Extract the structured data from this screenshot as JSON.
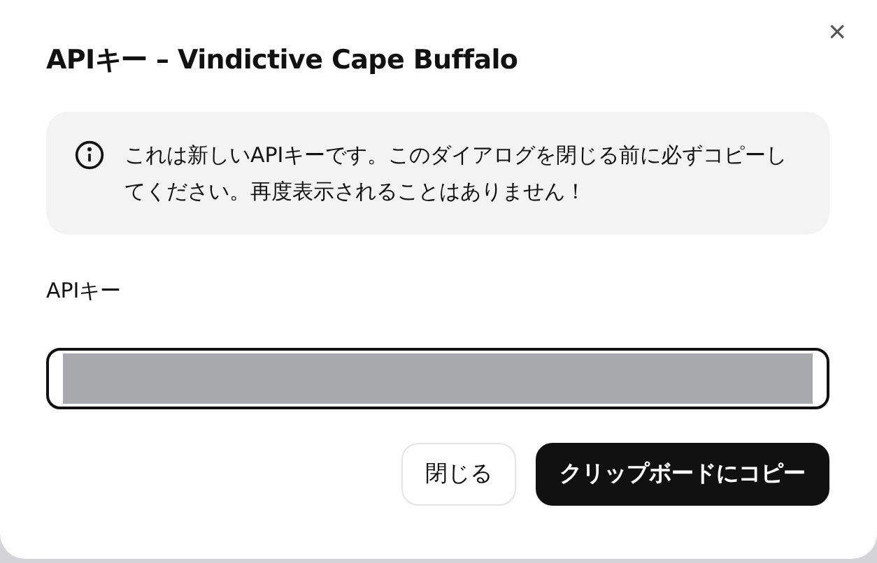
{
  "dialog": {
    "title": "APIキー – Vindictive Cape Buffalo",
    "close_label": "×"
  },
  "notice": {
    "text": "これは新しいAPIキーです。このダイアログを閉じる前に必ずコピーしてください。再度表示されることはありません！"
  },
  "field": {
    "label": "APIキー",
    "redacted": true
  },
  "buttons": [
    {
      "label": "閉じる",
      "kind": "secondary"
    },
    {
      "label": "クリップボードにコピー",
      "kind": "primary"
    }
  ]
}
